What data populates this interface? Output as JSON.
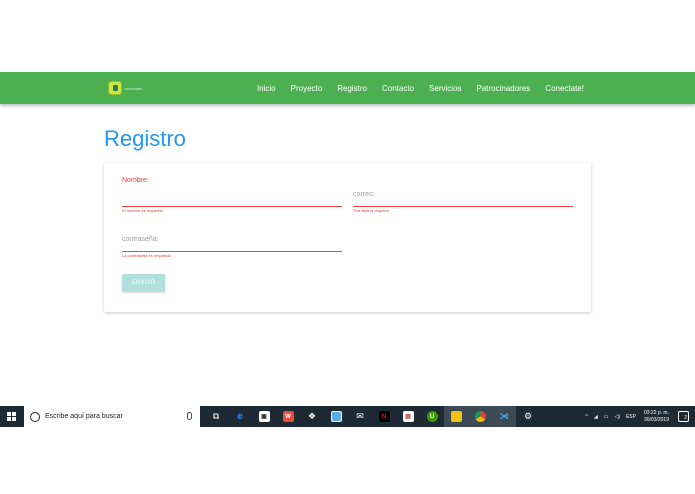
{
  "navbar": {
    "logo_text": "conectate",
    "links": [
      "Inicio",
      "Proyecto",
      "Registro",
      "Contacto",
      "Servicios",
      "Patrocinadores",
      "Conectate!"
    ]
  },
  "page_title": "Registro",
  "form": {
    "nombre": {
      "label": "Nombre:",
      "value": "",
      "error": "El nombre es requerido"
    },
    "correo": {
      "label": "correo:",
      "value": "",
      "error": "This field is required"
    },
    "contrasena": {
      "label": "contraseña:",
      "value": "",
      "error": "La contraseña es requerida"
    },
    "submit_label": "ENVIAR"
  },
  "taskbar": {
    "search_placeholder": "Escribe aquí para buscar",
    "apps": [
      "task-view",
      "edge",
      "store",
      "office",
      "dropbox",
      "photos",
      "mail",
      "netflix",
      "calculator",
      "upwork",
      "file-explorer",
      "chrome",
      "vscode",
      "settings"
    ],
    "tray": {
      "chevron": "^",
      "lang": "ESP",
      "time": "03:22 p. m.",
      "date": "30/03/2019",
      "notifications": "2"
    }
  },
  "colors": {
    "navbar": "#4caf50",
    "title": "#2196f3",
    "error": "#e53935",
    "button": "#b2dfdb",
    "taskbar": "#1e2a33"
  }
}
